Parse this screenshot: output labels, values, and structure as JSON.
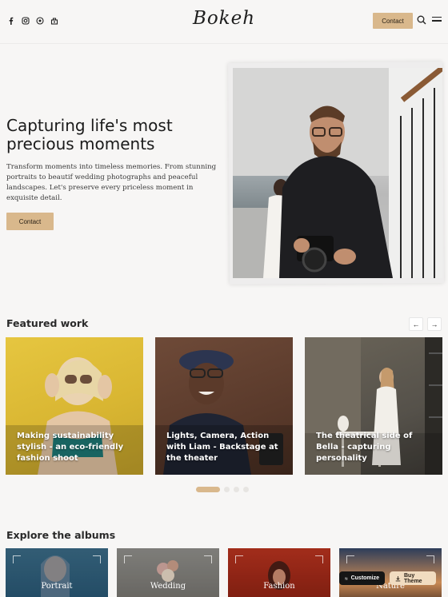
{
  "header": {
    "logo": "Bokeh",
    "contact_label": "Contact",
    "social_icons": [
      "facebook-icon",
      "instagram-icon",
      "pinterest-icon",
      "tripadvisor-icon"
    ]
  },
  "hero": {
    "title": "Capturing life's most precious moments",
    "text": "Transform moments into timeless memories. From stunning portraits to beautif wedding photographs and peaceful landscapes. Let's preserve every priceless moment in exquisite detail.",
    "button_label": "Contact"
  },
  "featured": {
    "heading": "Featured work",
    "prev_label": "←",
    "next_label": "→",
    "cards": [
      {
        "title": "Making sustainability stylish - an eco-friendly fashion shoot"
      },
      {
        "title": "Lights, Camera, Action with Liam - Backstage at the theater"
      },
      {
        "title": "The theatrical side of Bella - capturing personality"
      }
    ],
    "dots": 4,
    "active_dot": 1
  },
  "albums": {
    "heading": "Explore the albums",
    "items": [
      {
        "label": "Portrait"
      },
      {
        "label": "Wedding"
      },
      {
        "label": "Fashion"
      },
      {
        "label": "Nature"
      }
    ]
  },
  "floating": {
    "customize_label": "Customize",
    "buy_label": "Buy Theme"
  },
  "colors": {
    "accent": "#d9b88c",
    "background": "#f7f6f5"
  }
}
